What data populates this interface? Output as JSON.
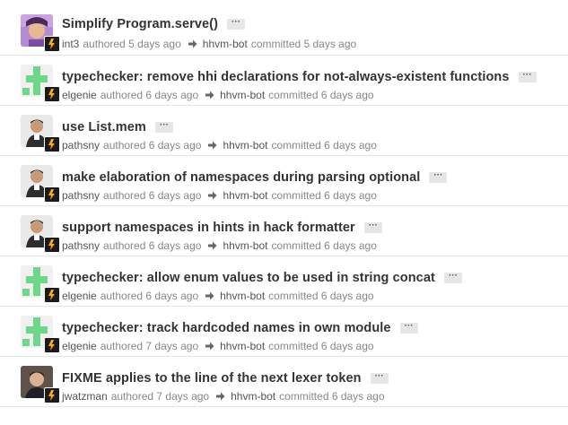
{
  "commits": [
    {
      "title": "Simplify Program.serve()",
      "author": "int3",
      "authored": "authored 5 days ago",
      "committer": "hhvm-bot",
      "committed": "committed 5 days ago",
      "avatar": "photo-avatar-purple"
    },
    {
      "title": "typechecker: remove hhi declarations for not-always-existent functions",
      "author": "elgenie",
      "authored": "authored 6 days ago",
      "committer": "hhvm-bot",
      "committed": "committed 6 days ago",
      "avatar": "identicon-green"
    },
    {
      "title": "use List.mem",
      "author": "pathsny",
      "authored": "authored 6 days ago",
      "committer": "hhvm-bot",
      "committed": "committed 6 days ago",
      "avatar": "photo-avatar-person"
    },
    {
      "title": "make elaboration of namespaces during parsing optional",
      "author": "pathsny",
      "authored": "authored 6 days ago",
      "committer": "hhvm-bot",
      "committed": "committed 6 days ago",
      "avatar": "photo-avatar-person"
    },
    {
      "title": "support namespaces in hints in hack formatter",
      "author": "pathsny",
      "authored": "authored 6 days ago",
      "committer": "hhvm-bot",
      "committed": "committed 6 days ago",
      "avatar": "photo-avatar-person"
    },
    {
      "title": "typechecker: allow enum values to be used in string concat",
      "author": "elgenie",
      "authored": "authored 6 days ago",
      "committer": "hhvm-bot",
      "committed": "committed 6 days ago",
      "avatar": "identicon-green"
    },
    {
      "title": "typechecker: track hardcoded names in own module",
      "author": "elgenie",
      "authored": "authored 7 days ago",
      "committer": "hhvm-bot",
      "committed": "committed 6 days ago",
      "avatar": "identicon-green"
    },
    {
      "title": "FIXME applies to the line of the next lexer token",
      "author": "jwatzman",
      "authored": "authored 7 days ago",
      "committer": "hhvm-bot",
      "committed": "committed 6 days ago",
      "avatar": "photo-avatar-man"
    }
  ],
  "ellipsis_label": "···",
  "colors": {
    "identicon": "#6fd68a",
    "bot_bg": "#1b1b1b",
    "bot_mark": "#f5a623"
  }
}
